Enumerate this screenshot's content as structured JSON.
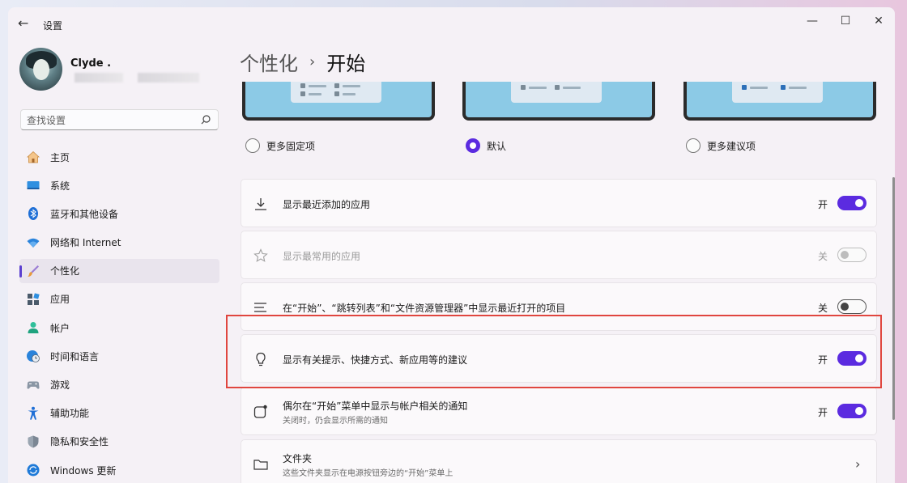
{
  "window": {
    "title": "设置",
    "back_glyph": "←",
    "minimize_glyph": "—",
    "maximize_glyph": "☐",
    "close_glyph": "✕"
  },
  "profile": {
    "name": "Clyde ."
  },
  "search": {
    "placeholder": "查找设置",
    "icon": "search-icon"
  },
  "sidebar": {
    "items": [
      {
        "label": "主页",
        "icon": "home-icon"
      },
      {
        "label": "系统",
        "icon": "monitor-icon"
      },
      {
        "label": "蓝牙和其他设备",
        "icon": "bluetooth-icon"
      },
      {
        "label": "网络和 Internet",
        "icon": "wifi-icon"
      },
      {
        "label": "个性化",
        "icon": "brush-icon",
        "active": true
      },
      {
        "label": "应用",
        "icon": "apps-icon"
      },
      {
        "label": "帐户",
        "icon": "person-icon"
      },
      {
        "label": "时间和语言",
        "icon": "globe-clock-icon"
      },
      {
        "label": "游戏",
        "icon": "gamepad-icon"
      },
      {
        "label": "辅助功能",
        "icon": "accessibility-icon"
      },
      {
        "label": "隐私和安全性",
        "icon": "shield-icon"
      },
      {
        "label": "Windows 更新",
        "icon": "update-icon"
      }
    ]
  },
  "breadcrumb": {
    "parent": "个性化",
    "separator": "›",
    "current": "开始"
  },
  "layout_options": [
    {
      "label": "更多固定项",
      "selected": false
    },
    {
      "label": "默认",
      "selected": true
    },
    {
      "label": "更多建议项",
      "selected": false
    }
  ],
  "settings": [
    {
      "title": "显示最近添加的应用",
      "state_label": "开",
      "state": "on",
      "icon": "download-icon"
    },
    {
      "title": "显示最常用的应用",
      "state_label": "关",
      "state": "disabled",
      "icon": "star-icon"
    },
    {
      "title": "在“开始”、“跳转列表”和“文件资源管理器”中显示最近打开的项目",
      "state_label": "关",
      "state": "off",
      "icon": "list-icon"
    },
    {
      "title": "显示有关提示、快捷方式、新应用等的建议",
      "state_label": "开",
      "state": "on",
      "icon": "lightbulb-icon"
    },
    {
      "title": "偶尔在“开始”菜单中显示与帐户相关的通知",
      "subtitle": "关闭时，仍会显示所需的通知",
      "state_label": "开",
      "state": "on",
      "icon": "notification-icon"
    },
    {
      "title": "文件夹",
      "subtitle": "这些文件夹显示在电源按钮旁边的“开始”菜单上",
      "icon": "folder-icon",
      "chevron": "›"
    }
  ],
  "colors": {
    "accent": "#5b2be0",
    "highlight": "#e0463f"
  }
}
